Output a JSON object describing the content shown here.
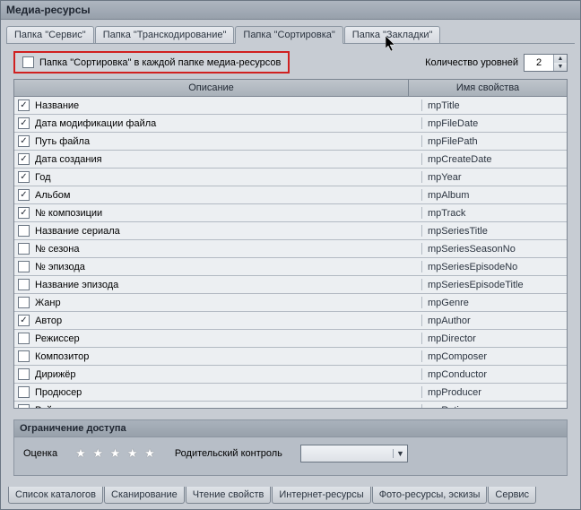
{
  "title": "Медиа-ресурсы",
  "tabs": [
    {
      "label": "Папка \"Сервис\""
    },
    {
      "label": "Папка \"Транскодирование\""
    },
    {
      "label": "Папка \"Сортировка\""
    },
    {
      "label": "Папка \"Закладки\""
    }
  ],
  "active_tab": 2,
  "option": {
    "label": "Папка \"Сортировка\" в каждой папке медиа-ресурсов",
    "checked": false
  },
  "levels": {
    "label": "Количество уровней",
    "value": "2"
  },
  "columns": {
    "desc": "Описание",
    "prop": "Имя свойства"
  },
  "rows": [
    {
      "checked": true,
      "desc": "Название",
      "prop": "mpTitle"
    },
    {
      "checked": true,
      "desc": "Дата модификации файла",
      "prop": "mpFileDate"
    },
    {
      "checked": true,
      "desc": "Путь файла",
      "prop": "mpFilePath"
    },
    {
      "checked": true,
      "desc": "Дата создания",
      "prop": "mpCreateDate"
    },
    {
      "checked": true,
      "desc": "Год",
      "prop": "mpYear"
    },
    {
      "checked": true,
      "desc": "Альбом",
      "prop": "mpAlbum"
    },
    {
      "checked": true,
      "desc": "№ композиции",
      "prop": "mpTrack"
    },
    {
      "checked": false,
      "desc": "Название сериала",
      "prop": "mpSeriesTitle"
    },
    {
      "checked": false,
      "desc": "№ сезона",
      "prop": "mpSeriesSeasonNo"
    },
    {
      "checked": false,
      "desc": "№ эпизода",
      "prop": "mpSeriesEpisodeNo"
    },
    {
      "checked": false,
      "desc": "Название эпизода",
      "prop": "mpSeriesEpisodeTitle"
    },
    {
      "checked": false,
      "desc": "Жанр",
      "prop": "mpGenre"
    },
    {
      "checked": true,
      "desc": "Автор",
      "prop": "mpAuthor"
    },
    {
      "checked": false,
      "desc": "Режиссер",
      "prop": "mpDirector"
    },
    {
      "checked": false,
      "desc": "Композитор",
      "prop": "mpComposer"
    },
    {
      "checked": false,
      "desc": "Дирижёр",
      "prop": "mpConductor"
    },
    {
      "checked": false,
      "desc": "Продюсер",
      "prop": "mpProducer"
    },
    {
      "checked": false,
      "desc": "Рейтинг",
      "prop": "mpRating"
    }
  ],
  "footer": {
    "title": "Ограничение доступа",
    "rating_label": "Оценка",
    "parental_label": "Родительский контроль",
    "parental_value": ""
  },
  "bottom_tabs": [
    {
      "label": "Список каталогов"
    },
    {
      "label": "Сканирование"
    },
    {
      "label": "Чтение свойств"
    },
    {
      "label": "Интернет-ресурсы"
    },
    {
      "label": "Фото-ресурсы, эскизы"
    },
    {
      "label": "Сервис"
    }
  ]
}
